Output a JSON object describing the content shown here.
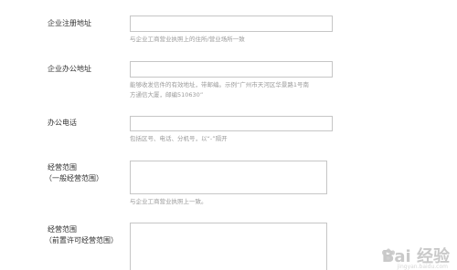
{
  "form": {
    "registered_address": {
      "label": "企业注册地址",
      "hint": "与企业工商营业执照上的住所/营业场所一致"
    },
    "office_address": {
      "label": "企业办公地址",
      "hint_line1": "能够收发信件的有效地址，带邮编。示例“广州市天河区华景路1号南",
      "hint_line2": "方通信大厦，邮编510630”"
    },
    "office_phone": {
      "label": "办公电话",
      "hint": "包括区号、电话、分机号，以“-”隔开"
    },
    "general_scope": {
      "label_line1": "经营范围",
      "label_line2": "（一般经营范围）",
      "hint": "与企业工商营业执照上一致。"
    },
    "licensed_scope": {
      "label_line1": "经营范围",
      "label_line2": "（前置许可经营范围）"
    }
  },
  "watermark": {
    "logo_text": "Bai 经验",
    "sub_text": "jingyan.baidu.com"
  }
}
